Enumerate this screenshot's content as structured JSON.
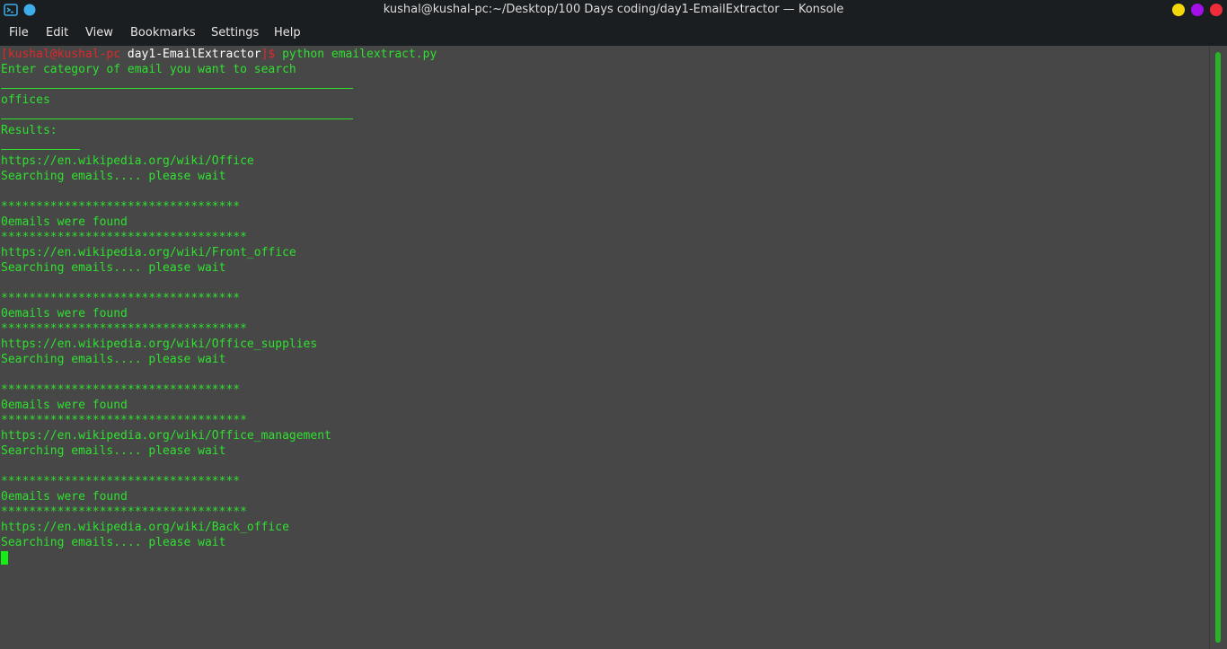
{
  "window": {
    "title": "kushal@kushal-pc:~/Desktop/100 Days coding/day1-EmailExtractor — Konsole",
    "app_icon": "terminal-icon",
    "pin_icon": "pin-icon",
    "controls": {
      "minimize_color": "#f4d70b",
      "maximize_color": "#a310e8",
      "close_color": "#ee2c3a"
    }
  },
  "menu": {
    "file": "File",
    "edit": "Edit",
    "view": "View",
    "bookmarks": "Bookmarks",
    "settings": "Settings",
    "help": "Help"
  },
  "terminal": {
    "prompt": {
      "open": "[",
      "user_host": "kushal@kushal-pc",
      "cwd": " day1-EmailExtractor",
      "close": "]$",
      "command": " python emailextract.py"
    },
    "lines": {
      "l1": "Enter category of email you want to search",
      "l2": "offices",
      "l3": "Results:",
      "l4": "https://en.wikipedia.org/wiki/Office",
      "l5": "Searching emails.... please wait",
      "l6": "**********************************",
      "l7": "0emails were found",
      "l8": "***********************************",
      "l9": "https://en.wikipedia.org/wiki/Front_office",
      "l10": "Searching emails.... please wait",
      "l11": "**********************************",
      "l12": "0emails were found",
      "l13": "***********************************",
      "l14": "https://en.wikipedia.org/wiki/Office_supplies",
      "l15": "Searching emails.... please wait",
      "l16": "**********************************",
      "l17": "0emails were found",
      "l18": "***********************************",
      "l19": "https://en.wikipedia.org/wiki/Office_management",
      "l20": "Searching emails.... please wait",
      "l21": "**********************************",
      "l22": "0emails were found",
      "l23": "***********************************",
      "l24": "https://en.wikipedia.org/wiki/Back_office",
      "l25": "Searching emails.... please wait"
    },
    "text_color": "#2fe02f",
    "background": "#474747"
  }
}
